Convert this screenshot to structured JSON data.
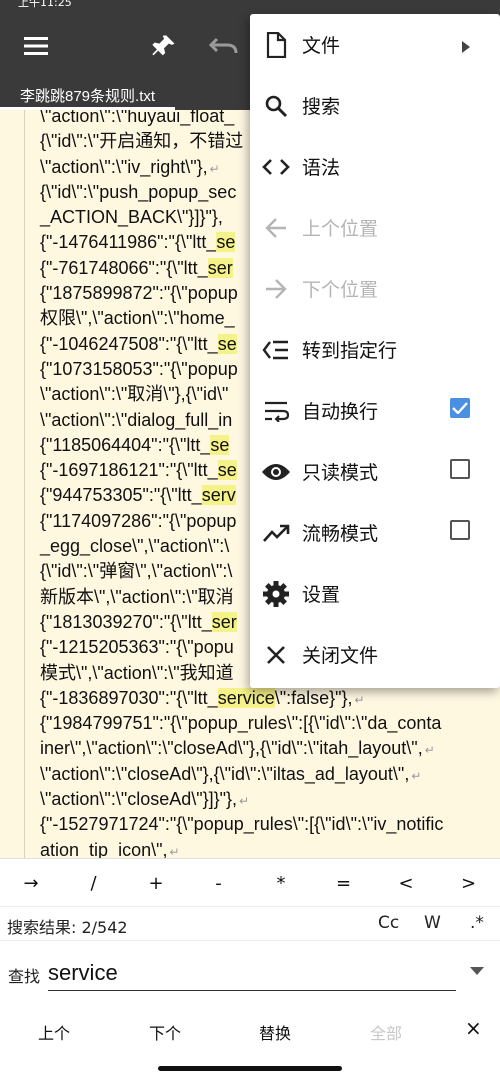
{
  "status_bar": {
    "time": "上午11:25"
  },
  "toolbar": {
    "menu_icon": "hamburger-icon",
    "pin_icon": "pin-icon",
    "undo_icon": "undo-icon"
  },
  "tab": {
    "filename": "李跳跳879条规则.txt"
  },
  "editor": {
    "lines": [
      {
        "pre": "\\\"action\\\":\\\"huyaui_float_",
        "hl": "",
        "post": "",
        "wrap": false
      },
      {
        "pre": "{\\\"id\\\":\\\"开启通知，不错过",
        "hl": "",
        "post": "",
        "wrap": false
      },
      {
        "pre": "\\\"action\\\":\\\"iv_right\\\"},",
        "hl": "",
        "post": "",
        "wrap": true
      },
      {
        "pre": "{\\\"id\\\":\\\"push_popup_sec",
        "hl": "",
        "post": "",
        "wrap": false
      },
      {
        "pre": "_ACTION_BACK\\\"}]}\"},",
        "hl": "",
        "post": "",
        "wrap": false
      },
      {
        "pre": "{\"-1476411986\":\"{\\\"ltt_",
        "hl": "se",
        "post": "",
        "wrap": false
      },
      {
        "pre": "{\"-761748066\":\"{\\\"ltt_",
        "hl": "ser",
        "post": "",
        "wrap": false
      },
      {
        "pre": "{\"1875899872\":\"{\\\"popup",
        "hl": "",
        "post": "",
        "wrap": false
      },
      {
        "pre": "权限\\\",\\\"action\\\":\\\"home_",
        "hl": "",
        "post": "",
        "wrap": false
      },
      {
        "pre": "{\"-1046247508\":\"{\\\"ltt_",
        "hl": "se",
        "post": "",
        "wrap": false
      },
      {
        "pre": "{\"1073158053\":\"{\\\"popup",
        "hl": "",
        "post": "",
        "wrap": false
      },
      {
        "pre": "\\\"action\\\":\\\"取消\\\"},{\\\"id\\\"",
        "hl": "",
        "post": "",
        "wrap": false
      },
      {
        "pre": "\\\"action\\\":\\\"dialog_full_in",
        "hl": "",
        "post": "",
        "wrap": false
      },
      {
        "pre": "{\"1185064404\":\"{\\\"ltt_",
        "hl": "se",
        "post": "",
        "wrap": false
      },
      {
        "pre": "{\"-1697186121\":\"{\\\"ltt_",
        "hl": "se",
        "post": "",
        "wrap": false
      },
      {
        "pre": "{\"944753305\":\"{\\\"ltt_",
        "hl": "serv",
        "post": "",
        "wrap": false
      },
      {
        "pre": "{\"1174097286\":\"{\\\"popup",
        "hl": "",
        "post": "",
        "wrap": false
      },
      {
        "pre": "_egg_close\\\",\\\"action\\\":\\",
        "hl": "",
        "post": "",
        "wrap": false
      },
      {
        "pre": "{\\\"id\\\":\\\"弹窗\\\",\\\"action\\\":\\",
        "hl": "",
        "post": "",
        "wrap": false
      },
      {
        "pre": "新版本\\\",\\\"action\\\":\\\"取消",
        "hl": "",
        "post": "",
        "wrap": false
      },
      {
        "pre": "{\"1813039270\":\"{\\\"ltt_",
        "hl": "ser",
        "post": "",
        "wrap": false
      },
      {
        "pre": "{\"-1215205363\":\"{\\\"popu",
        "hl": "",
        "post": "",
        "wrap": false
      },
      {
        "pre": "模式\\\",\\\"action\\\":\\\"我知道",
        "hl": "",
        "post": "",
        "wrap": false
      },
      {
        "pre": "{\"-1836897030\":\"{\\\"ltt_",
        "hl": "service",
        "post": "\\\":false}\"},",
        "wrap": true
      },
      {
        "pre": "{\"1984799751\":\"{\\\"popup_rules\\\":[{\\\"id\\\":\\\"da_conta",
        "hl": "",
        "post": "",
        "wrap": false
      },
      {
        "pre": "iner\\\",\\\"action\\\":\\\"closeAd\\\"},{\\\"id\\\":\\\"itah_layout\\\",",
        "hl": "",
        "post": "",
        "wrap": true
      },
      {
        "pre": "\\\"action\\\":\\\"closeAd\\\"},{\\\"id\\\":\\\"iltas_ad_layout\\\",",
        "hl": "",
        "post": "",
        "wrap": true
      },
      {
        "pre": "\\\"action\\\":\\\"closeAd\\\"}]}\"},",
        "hl": "",
        "post": "",
        "wrap": true
      },
      {
        "pre": "{\"-1527971724\":\"{\\\"popup_rules\\\":[{\\\"id\\\":\\\"iv_notific",
        "hl": "",
        "post": "",
        "wrap": false
      },
      {
        "pre": "ation_tip_icon\\\",",
        "hl": "",
        "post": "",
        "wrap": true
      }
    ]
  },
  "menu": {
    "items": [
      {
        "label": "文件",
        "icon": "file-icon",
        "disabled": false,
        "trailing": "submenu-arrow"
      },
      {
        "label": "搜索",
        "icon": "search-icon",
        "disabled": false,
        "trailing": ""
      },
      {
        "label": "语法",
        "icon": "code-icon",
        "disabled": false,
        "trailing": ""
      },
      {
        "label": "上个位置",
        "icon": "arrow-left-icon",
        "disabled": true,
        "trailing": ""
      },
      {
        "label": "下个位置",
        "icon": "arrow-right-icon",
        "disabled": true,
        "trailing": ""
      },
      {
        "label": "转到指定行",
        "icon": "goto-line-icon",
        "disabled": false,
        "trailing": ""
      },
      {
        "label": "自动换行",
        "icon": "wrap-text-icon",
        "disabled": false,
        "trailing": "checkbox-checked"
      },
      {
        "label": "只读模式",
        "icon": "eye-icon",
        "disabled": false,
        "trailing": "checkbox"
      },
      {
        "label": "流畅模式",
        "icon": "trending-icon",
        "disabled": false,
        "trailing": "checkbox"
      },
      {
        "label": "设置",
        "icon": "gear-icon",
        "disabled": false,
        "trailing": ""
      },
      {
        "label": "关闭文件",
        "icon": "close-icon",
        "disabled": false,
        "trailing": ""
      }
    ]
  },
  "symbols": [
    "→",
    "/",
    "+",
    "-",
    "*",
    "=",
    "<",
    ">"
  ],
  "search": {
    "result_label": "搜索结果: 2/542",
    "opt_case": "Cc",
    "opt_word": "W",
    "opt_regex": ".*",
    "find_label": "查找",
    "find_value": "service"
  },
  "actions": {
    "prev": "上个",
    "next": "下个",
    "replace": "替换",
    "all": "全部",
    "close": "×"
  }
}
